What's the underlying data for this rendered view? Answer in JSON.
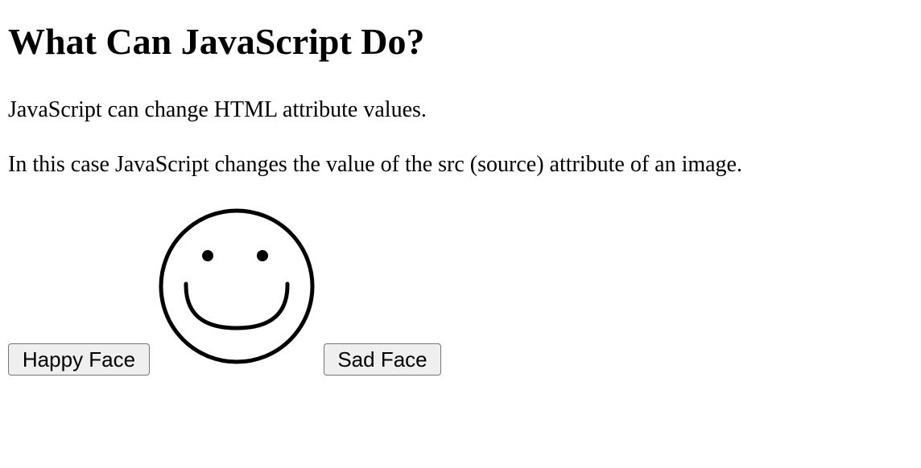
{
  "heading": "What Can JavaScript Do?",
  "paragraphs": {
    "first": "JavaScript can change HTML attribute values.",
    "second": "In this case JavaScript changes the value of the src (source) attribute of an image."
  },
  "buttons": {
    "happy_label": "Happy Face",
    "sad_label": "Sad Face"
  },
  "image": {
    "current_face": "smiley-face-icon"
  }
}
